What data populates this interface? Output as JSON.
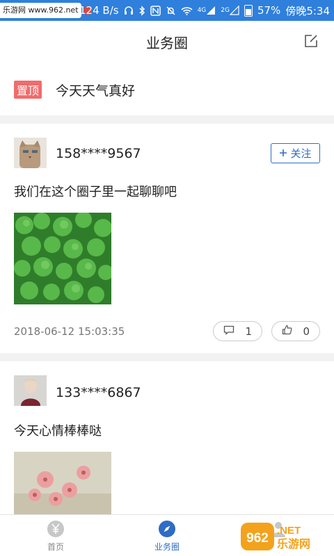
{
  "status_bar": {
    "watermark": "乐游网 www.962.net",
    "speed": "124 B/s",
    "signal_1": "4G",
    "signal_2": "2G",
    "battery": "57%",
    "time": "傍晚5:34"
  },
  "header": {
    "title": "业务圈"
  },
  "pinned": {
    "tag": "置顶",
    "text": "今天天气真好"
  },
  "posts": [
    {
      "username": "158****9567",
      "follow_label": "关注",
      "content": "我们在这个圈子里一起聊聊吧",
      "date": "2018-06-12 15:03:35",
      "comments": "1",
      "likes": "0"
    },
    {
      "username": "133****6867",
      "content": "今天心情棒棒哒"
    }
  ],
  "tabbar": {
    "items": [
      {
        "label": "首页"
      },
      {
        "label": "业务圈"
      }
    ]
  },
  "logo": {
    "number": "962",
    "suffix": ".NET",
    "text": "乐游网"
  },
  "colors": {
    "status_bar": "#2f7fdc",
    "accent": "#2f6cc5",
    "pin_tag": "#f06c6c"
  }
}
